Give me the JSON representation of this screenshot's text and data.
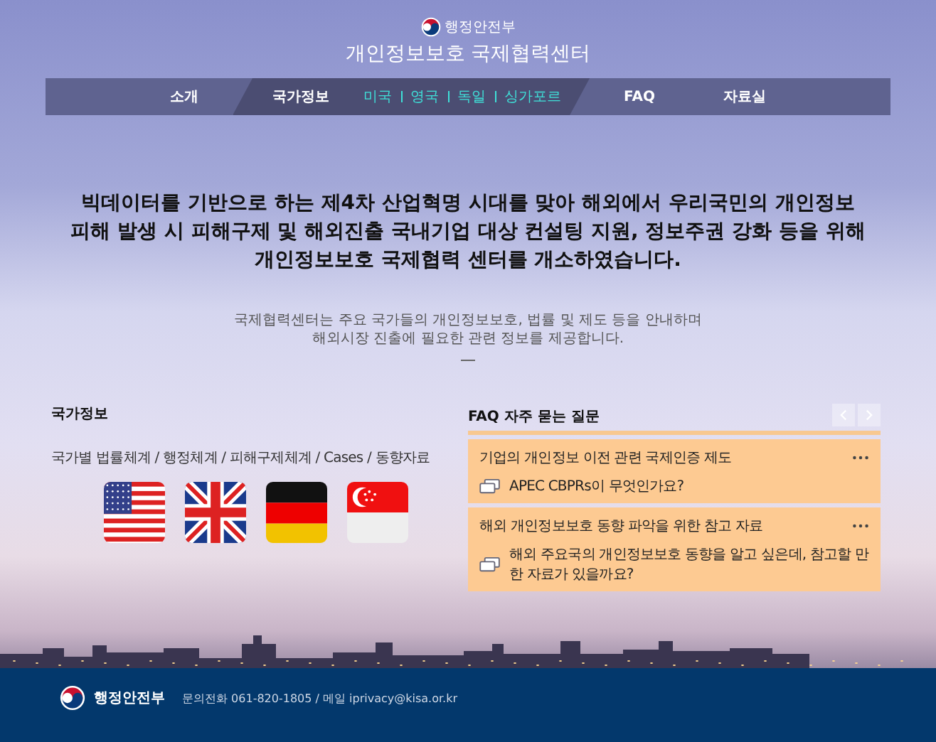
{
  "header": {
    "ministry": "행정안전부",
    "title": "개인정보보호 국제협력센터"
  },
  "nav": [
    {
      "label": "소개",
      "selected": false
    },
    {
      "label": "국가정보",
      "selected": true,
      "sub_items": [
        "미국",
        "영국",
        "독일",
        "싱가포르"
      ]
    },
    {
      "label": "FAQ",
      "selected": false
    },
    {
      "label": "자료실",
      "selected": false
    }
  ],
  "headline": [
    "빅데이터를 기반으로 하는 제4차 산업혁명 시대를 맞아 해외에서 우리국민의 개인정보",
    "피해 발생 시 피해구제 및 해외진출 국내기업 대상 컨설팅 지원, 정보주권 강화 등을 위해",
    "개인정보보호 국제협력 센터를 개소하였습니다."
  ],
  "intro": [
    "국제협력센터는 주요 국가들의 개인정보보호, 법률 및 제도 등을 안내하며",
    "해외시장 진출에 필요한 관련 정보를 제공합니다."
  ],
  "country_info": {
    "heading": "국가정보",
    "categories": "국가별 법률체계 / 행정체계 / 피해구제체계 / Cases / 동향자료",
    "flags": [
      {
        "kind": "us"
      },
      {
        "kind": "uk"
      },
      {
        "kind": "de"
      },
      {
        "kind": "sg"
      }
    ]
  },
  "faq": {
    "heading": "FAQ 자주 묻는 질문",
    "items": [
      {
        "topic": "기업의 개인정보 이전 관련 국제인증 제도",
        "question": "APEC CBPRs이 무엇인가요?"
      },
      {
        "topic": "해외 개인정보보호 동향 파악을 위한 참고 자료",
        "question": "해외 주요국의 개인정보보호 동향을 알고 싶은데, 참고할 만한 자료가 있을까요?"
      }
    ]
  },
  "footer": {
    "ministry": "행정안전부",
    "contact": "문의전화 061-820-1805 / 메일 iprivacy@kisa.or.kr"
  }
}
